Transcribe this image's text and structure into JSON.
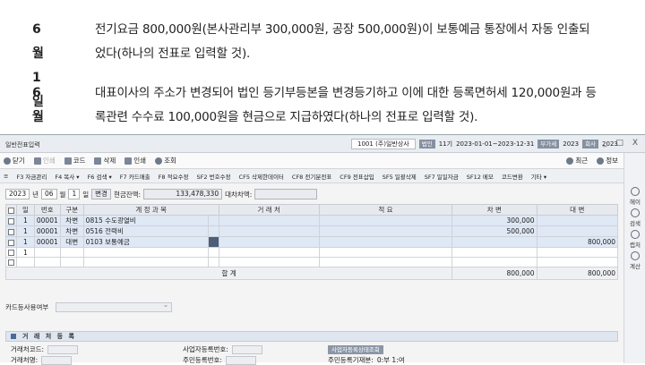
{
  "doc": {
    "q1_day": "6월 1일",
    "q1_text": "전기요금 800,000원(본사관리부 300,000원, 공장 500,000원)이 보통예금 통장에서 자동 인출되었다(하나의 전표로 입력할 것).",
    "q2_day": "6월 2일",
    "q2_text": "대표이사의 주소가 변경되어 법인 등기부등본을 변경등기하고 이에 대한 등록면허세 120,000원과 등록관련 수수료 100,000원을 현금으로 지급하였다(하나의 전표로 입력할 것)."
  },
  "window": {
    "title": "일반전표입력",
    "company_code": "1001",
    "company_name": "(주)일반상사",
    "period_tag": "법인",
    "period_no": "11기",
    "period_range": "2023-01-01~2023-12-31",
    "tax_tag": "부가세",
    "tax_year": "2023",
    "year_tag": "회사",
    "year": "2023",
    "win_minimize": "_",
    "win_restore": "□",
    "win_close": "X"
  },
  "toolbar1": {
    "close": "닫기",
    "print": "인쇄",
    "code": "코드",
    "delete": "삭제",
    "print2": "인쇄",
    "search": "조회",
    "recent": "최근",
    "info": "정보"
  },
  "toolbar2": [
    "F3 자금관리",
    "F4 복사 ▾",
    "F6 검색 ▾",
    "F7 카드매출",
    "F8 적요수정",
    "SF2 번호수정",
    "CF5 삭제한데이터",
    "CF8 전기분전표",
    "CF9 전표삽입",
    "SF5 일괄삭제",
    "SF7 일일자금",
    "SF12 메모",
    "코드변환",
    "기타 ▾"
  ],
  "sidebar": {
    "help": "헤이",
    "search": "검색",
    "capture": "캡처",
    "calc": "계산"
  },
  "filter": {
    "year": "2023",
    "year_label": "년",
    "month": "06",
    "month_label": "월",
    "day": "1",
    "day_label": "일",
    "change_label": "변경",
    "cash_label": "현금잔액:",
    "cash_value": "133,478,330",
    "diff_label": "대차차액:",
    "diff_value": ""
  },
  "grid": {
    "headers": [
      "일",
      "번호",
      "구분",
      "계 정 과 목",
      "거 래 처",
      "적 요",
      "차 변",
      "대 변"
    ],
    "rows": [
      {
        "day": "1",
        "no": "00001",
        "type": "차변",
        "account": "0815 수도광열비",
        "partner": "",
        "memo": "",
        "debit": "300,000",
        "credit": ""
      },
      {
        "day": "1",
        "no": "00001",
        "type": "차변",
        "account": "0516 전력비",
        "partner": "",
        "memo": "",
        "debit": "500,000",
        "credit": ""
      },
      {
        "day": "1",
        "no": "00001",
        "type": "대변",
        "account": "0103 보통예금",
        "partner": "",
        "memo": "",
        "debit": "",
        "credit": "800,000"
      },
      {
        "day": "1",
        "no": "",
        "type": "",
        "account": "",
        "partner": "",
        "memo": "",
        "debit": "",
        "credit": ""
      },
      {
        "day": "",
        "no": "",
        "type": "",
        "account": "",
        "partner": "",
        "memo": "",
        "debit": "",
        "credit": ""
      }
    ],
    "sum_label": "합 계",
    "sum_debit": "800,000",
    "sum_credit": "800,000"
  },
  "card": {
    "label": "카드등사용여부"
  },
  "partner_section": {
    "title": "거 래 처 등 록",
    "code_label": "거래처코드:",
    "name_label": "거래처명:",
    "bizno_label": "사업자등록번호:",
    "resno_label": "주민등록번호:",
    "lookup_btn": "사업자등록상태조회",
    "res_type_label": "주민등록기재분:",
    "res_type_value": "0:부 1:여"
  }
}
